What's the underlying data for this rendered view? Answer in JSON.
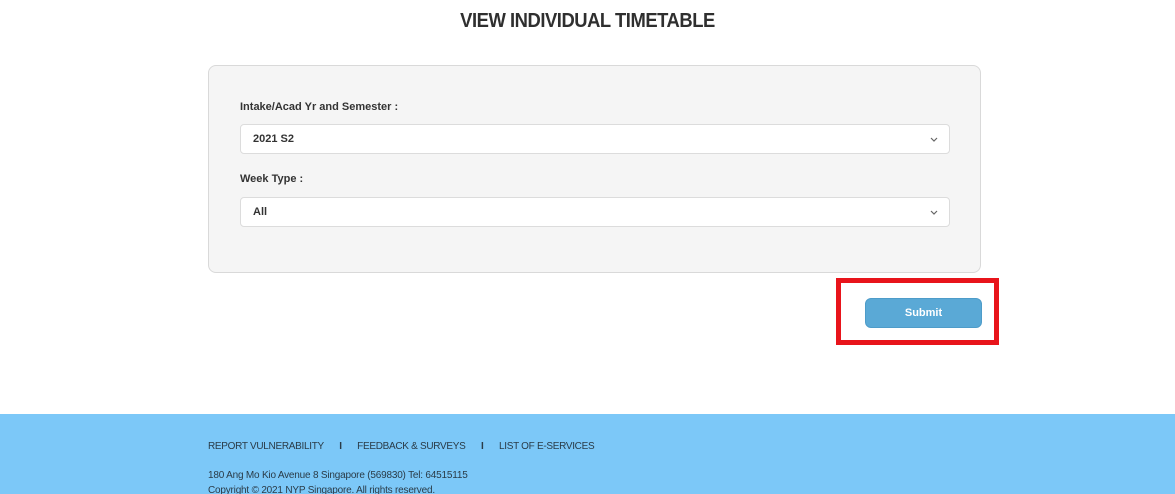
{
  "page": {
    "title": "VIEW INDIVIDUAL TIMETABLE"
  },
  "form": {
    "intake_label": "Intake/Acad Yr and Semester :",
    "intake_value": "2021 S2",
    "week_type_label": "Week Type :",
    "week_type_value": "All",
    "submit_label": "Submit"
  },
  "footer": {
    "links": [
      "REPORT VULNERABILITY",
      "FEEDBACK & SURVEYS",
      "LIST OF E-SERVICES"
    ],
    "separator": "I",
    "address": "180 Ang Mo Kio Avenue 8 Singapore (569830) Tel: 64515115",
    "copyright": "Copyright © 2021 NYP Singapore. All rights reserved."
  },
  "colors": {
    "highlight": "#e8141b",
    "submit_button": "#5aa9d6",
    "footer_background": "#7cc8f8"
  },
  "icons": {
    "dropdown": "chevron-down-icon"
  }
}
